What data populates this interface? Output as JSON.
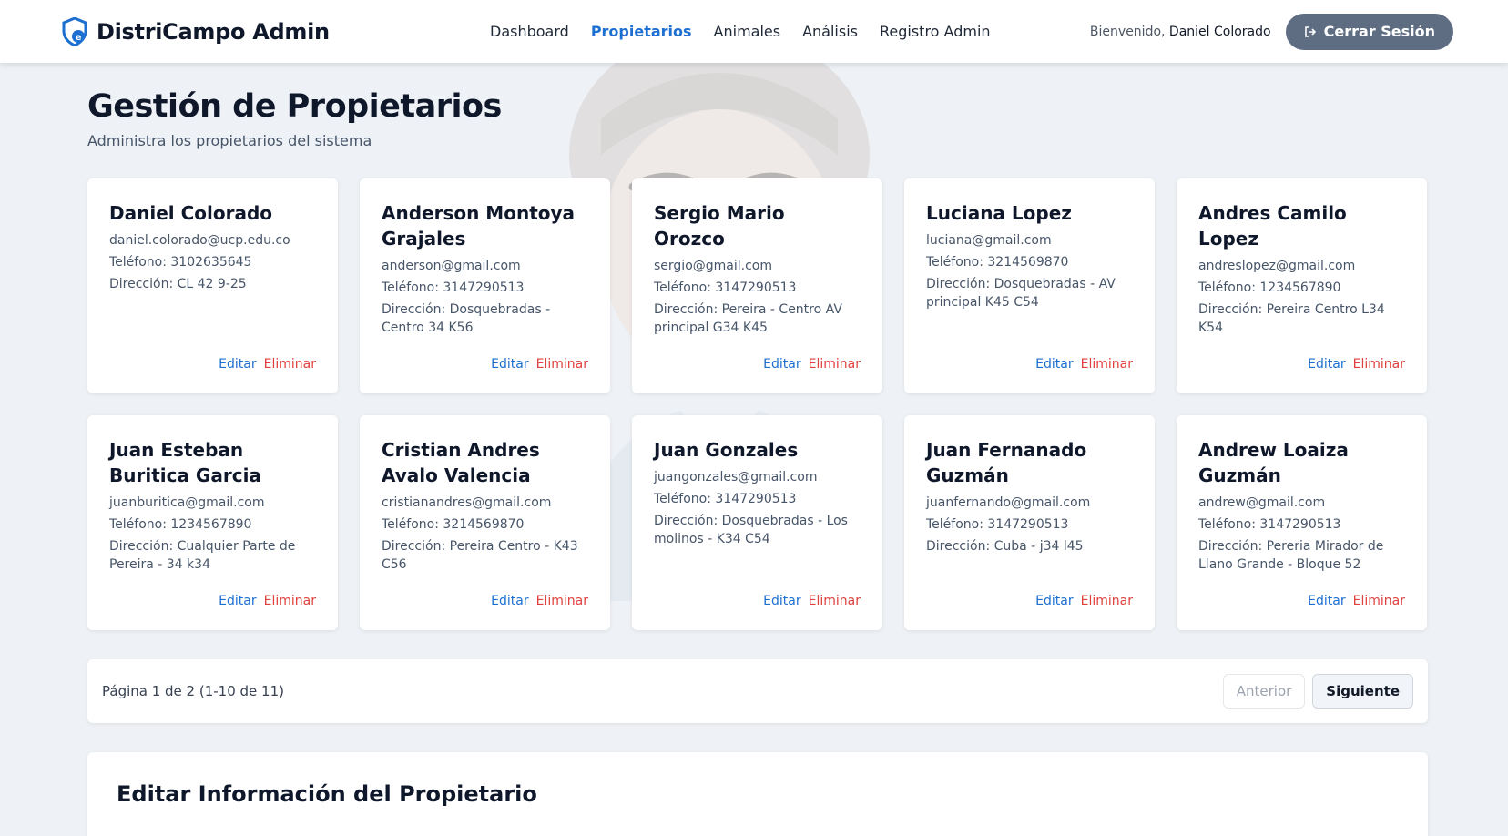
{
  "brand": {
    "name": "DistriCampo Admin",
    "icon": "shield-logo-icon"
  },
  "nav": {
    "items": [
      {
        "label": "Dashboard",
        "active": false
      },
      {
        "label": "Propietarios",
        "active": true
      },
      {
        "label": "Animales",
        "active": false
      },
      {
        "label": "Análisis",
        "active": false
      },
      {
        "label": "Registro Admin",
        "active": false
      }
    ],
    "welcome_prefix": "Bienvenido,",
    "user_name": "Daniel Colorado",
    "logout_label": "Cerrar Sesión"
  },
  "page": {
    "title": "Gestión de Propietarios",
    "subtitle": "Administra los propietarios del sistema"
  },
  "owners": [
    {
      "name": "Daniel Colorado",
      "email": "daniel.colorado@ucp.edu.co",
      "phone": "Teléfono: 3102635645",
      "address": "Dirección: CL 42 9-25"
    },
    {
      "name": "Anderson Montoya Grajales",
      "email": "anderson@gmail.com",
      "phone": "Teléfono: 3147290513",
      "address": "Dirección: Dosquebradas - Centro 34 K56"
    },
    {
      "name": "Sergio Mario Orozco",
      "email": "sergio@gmail.com",
      "phone": "Teléfono: 3147290513",
      "address": "Dirección: Pereira - Centro AV principal G34 K45"
    },
    {
      "name": "Luciana Lopez",
      "email": "luciana@gmail.com",
      "phone": "Teléfono: 3214569870",
      "address": "Dirección: Dosquebradas - AV principal K45 C54"
    },
    {
      "name": "Andres Camilo Lopez",
      "email": "andreslopez@gmail.com",
      "phone": "Teléfono: 1234567890",
      "address": "Dirección: Pereira Centro L34 K54"
    },
    {
      "name": "Juan Esteban Buritica Garcia",
      "email": "juanburitica@gmail.com",
      "phone": "Teléfono: 1234567890",
      "address": "Dirección: Cualquier Parte de Pereira - 34 k34"
    },
    {
      "name": "Cristian Andres Avalo Valencia",
      "email": "cristianandres@gmail.com",
      "phone": "Teléfono: 3214569870",
      "address": "Dirección: Pereira Centro - K43 C56"
    },
    {
      "name": "Juan Gonzales",
      "email": "juangonzales@gmail.com",
      "phone": "Teléfono: 3147290513",
      "address": "Dirección: Dosquebradas - Los molinos - K34 C54"
    },
    {
      "name": "Juan Fernanado Guzmán",
      "email": "juanfernando@gmail.com",
      "phone": "Teléfono: 3147290513",
      "address": "Dirección: Cuba - j34 l45"
    },
    {
      "name": "Andrew Loaiza Guzmán",
      "email": "andrew@gmail.com",
      "phone": "Teléfono: 3147290513",
      "address": "Dirección: Pereria Mirador de Llano Grande - Bloque 52"
    }
  ],
  "card_actions": {
    "edit_label": "Editar",
    "delete_label": "Eliminar"
  },
  "pagination": {
    "info": "Página 1 de 2 (1-10 de 11)",
    "prev_label": "Anterior",
    "next_label": "Siguiente"
  },
  "edit_panel": {
    "title": "Editar Información del Propietario"
  },
  "colors": {
    "accent": "#1d6fd1",
    "danger": "#e0413e",
    "logout_bg": "#5e6d82",
    "page_bg": "#eef1f5"
  }
}
